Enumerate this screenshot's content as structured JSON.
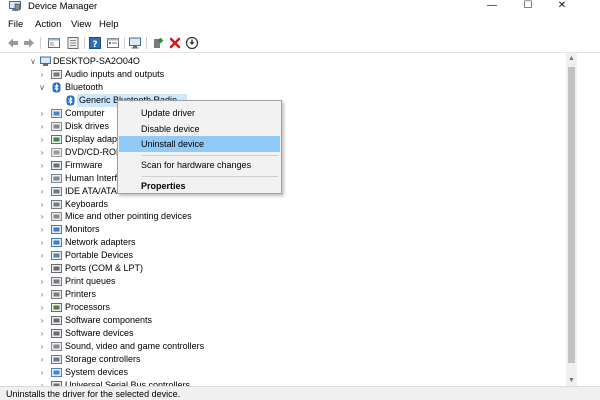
{
  "window": {
    "title": "Device Manager",
    "min_glyph": "—",
    "max_glyph": "☐",
    "close_glyph": "✕"
  },
  "menu": {
    "file": "File",
    "action": "Action",
    "view": "View",
    "help": "Help"
  },
  "toolbar": [
    "back-icon",
    "forward-icon",
    "properties-window-icon",
    "update-driver-icon",
    "help-icon",
    "show-hidden-icon",
    "monitor-scan-icon",
    "add-driver-icon",
    "uninstall-icon",
    "download-icon"
  ],
  "tree": {
    "root": "DESKTOP-SA2O04O",
    "items": [
      {
        "label": "Audio inputs and outputs",
        "icon": "speaker-icon"
      },
      {
        "label": "Bluetooth",
        "icon": "bluetooth-icon",
        "expanded": true
      },
      {
        "label": "Generic Bluetooth Radio",
        "icon": "bluetooth-radio-icon",
        "child": true,
        "selected": true
      },
      {
        "label": "Computer",
        "icon": "computer-icon"
      },
      {
        "label": "Disk drives",
        "icon": "disk-icon"
      },
      {
        "label": "Display adapt",
        "icon": "display-adapter-icon"
      },
      {
        "label": "DVD/CD-ROM",
        "icon": "dvd-icon"
      },
      {
        "label": "Firmware",
        "icon": "firmware-icon"
      },
      {
        "label": "Human Interf",
        "icon": "hid-icon"
      },
      {
        "label": "IDE ATA/ATAP",
        "icon": "ide-icon"
      },
      {
        "label": "Keyboards",
        "icon": "keyboard-icon"
      },
      {
        "label": "Mice and other pointing devices",
        "icon": "mouse-icon"
      },
      {
        "label": "Monitors",
        "icon": "monitor-icon"
      },
      {
        "label": "Network adapters",
        "icon": "network-icon"
      },
      {
        "label": "Portable Devices",
        "icon": "portable-device-icon"
      },
      {
        "label": "Ports (COM & LPT)",
        "icon": "port-icon"
      },
      {
        "label": "Print queues",
        "icon": "print-queue-icon"
      },
      {
        "label": "Printers",
        "icon": "printer-icon"
      },
      {
        "label": "Processors",
        "icon": "processor-icon"
      },
      {
        "label": "Software components",
        "icon": "software-component-icon"
      },
      {
        "label": "Software devices",
        "icon": "software-device-icon"
      },
      {
        "label": "Sound, video and game controllers",
        "icon": "sound-icon"
      },
      {
        "label": "Storage controllers",
        "icon": "storage-icon"
      },
      {
        "label": "System devices",
        "icon": "system-device-icon"
      },
      {
        "label": "Universal Serial Bus controllers",
        "icon": "usb-icon"
      }
    ]
  },
  "context_menu": {
    "update_driver": "Update driver",
    "disable_device": "Disable device",
    "uninstall_device": "Uninstall device",
    "scan_changes": "Scan for hardware changes",
    "properties": "Properties"
  },
  "status": {
    "text": "Uninstalls the driver for the selected device."
  },
  "colors": {
    "selection": "#cce8ff",
    "menu_highlight": "#91c9f7",
    "bluetooth": "#1f6fd1",
    "uninstall_red": "#d11b1b",
    "add_driver_green": "#2e8b2e"
  }
}
